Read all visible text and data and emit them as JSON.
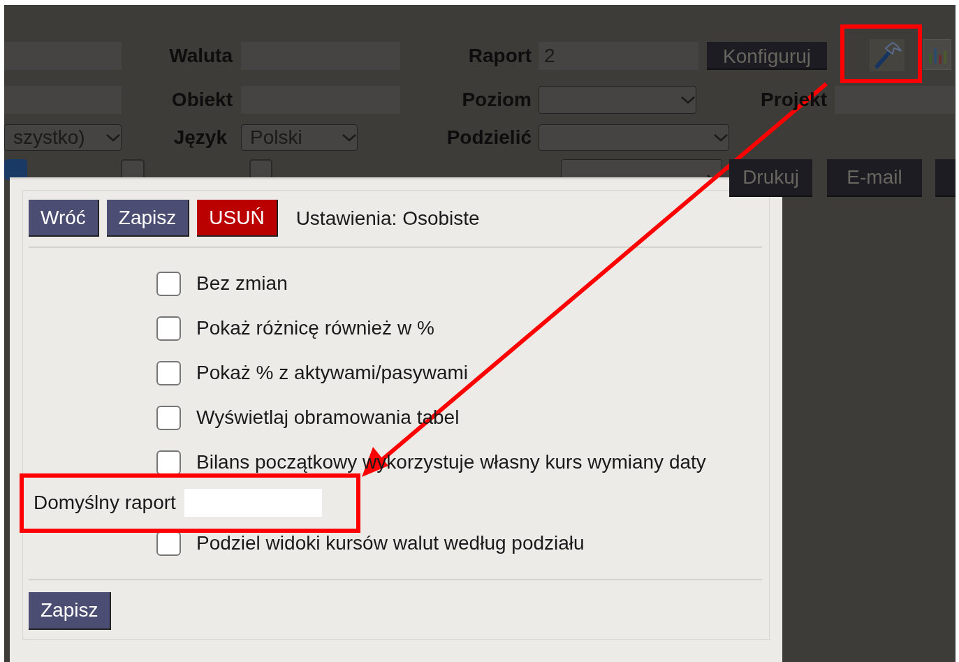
{
  "filters": [
    [
      {
        "kind": "field"
      },
      {
        "kind": "label",
        "text": "Waluta"
      },
      {
        "kind": "field"
      },
      {
        "kind": "label",
        "text": "Raport"
      },
      {
        "kind": "field",
        "value": "2"
      },
      {
        "kind": "button",
        "label": "Konfiguruj"
      },
      {
        "kind": "hammer"
      },
      {
        "kind": "chart"
      }
    ],
    [
      {
        "kind": "field"
      },
      {
        "kind": "label",
        "text": "Obiekt"
      },
      {
        "kind": "field"
      },
      {
        "kind": "label",
        "text": "Poziom"
      },
      {
        "kind": "select"
      },
      {
        "kind": "label",
        "text": "Projekt"
      },
      {
        "kind": "field"
      }
    ],
    [
      {
        "kind": "select",
        "value": "szystko)"
      },
      {
        "kind": "label",
        "text": "Język"
      },
      {
        "kind": "select",
        "value": "Polski"
      },
      {
        "kind": "label",
        "text": "Podzielić"
      },
      {
        "kind": "select"
      }
    ],
    [
      {
        "kind": "checkbox",
        "checked": true
      },
      {
        "kind": "checkbox",
        "checked": false
      },
      {
        "kind": "checkbox",
        "checked": false
      },
      {
        "kind": "select"
      },
      {
        "kind": "button",
        "label": "Drukuj"
      },
      {
        "kind": "button",
        "label": "E-mail"
      },
      {
        "kind": "button"
      }
    ]
  ],
  "dialog": {
    "buttons": [
      {
        "label": "Wróć",
        "kind": "normal"
      },
      {
        "label": "Zapisz",
        "kind": "normal"
      },
      {
        "label": "USUŃ",
        "kind": "danger"
      }
    ],
    "title": "Ustawienia: Osobiste",
    "options": [
      {
        "kind": "checkbox",
        "label": "Bez zmian",
        "checked": false
      },
      {
        "kind": "checkbox",
        "label": "Pokaż różnicę również w %",
        "checked": false
      },
      {
        "kind": "checkbox",
        "label": "Pokaż % z aktywami/pasywami",
        "checked": false
      },
      {
        "kind": "checkbox",
        "label": "Wyświetlaj obramowania tabel",
        "checked": false
      },
      {
        "kind": "checkbox",
        "label": "Bilans początkowy wykorzystuje własny kurs wymiany daty",
        "checked": false
      },
      {
        "kind": "field",
        "label": "Domyślny raport"
      },
      {
        "kind": "checkbox",
        "label": "Podziel widoki kursów walut według podziału",
        "checked": false
      }
    ],
    "footer_button": "Zapisz"
  }
}
